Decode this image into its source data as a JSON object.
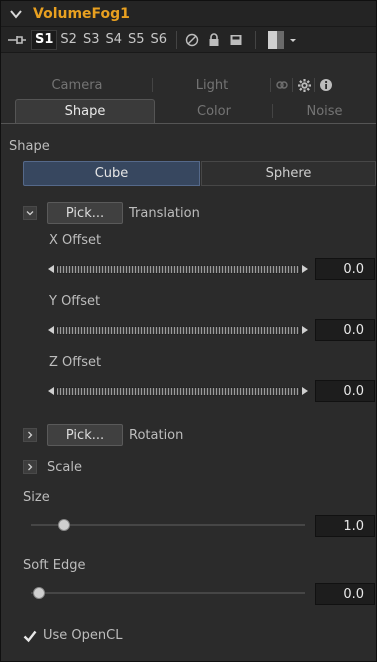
{
  "node": {
    "title": "VolumeFog1"
  },
  "versions": {
    "items": [
      "S1",
      "S2",
      "S3",
      "S4",
      "S5",
      "S6"
    ],
    "active_index": 0
  },
  "tabs_row1": [
    "Camera",
    "Light"
  ],
  "tabs_row2": [
    "Shape",
    "Color",
    "Noise"
  ],
  "active_tab": "Shape",
  "shape": {
    "section_label": "Shape",
    "options": [
      "Cube",
      "Sphere"
    ],
    "selected": "Cube"
  },
  "translation": {
    "pick_label": "Pick...",
    "label": "Translation",
    "x_label": "X Offset",
    "x_value": "0.0",
    "y_label": "Y Offset",
    "y_value": "0.0",
    "z_label": "Z Offset",
    "z_value": "0.0"
  },
  "rotation": {
    "pick_label": "Pick...",
    "label": "Rotation"
  },
  "scale": {
    "label": "Scale"
  },
  "size": {
    "label": "Size",
    "value": "1.0",
    "slider_fraction": 0.12
  },
  "soft_edge": {
    "label": "Soft Edge",
    "value": "0.0",
    "slider_fraction": 0.03
  },
  "opencl": {
    "label": "Use OpenCL",
    "checked": true
  },
  "colors": {
    "title": "#e8a020",
    "panel_bg": "#2b2b2b",
    "selected_segment": "#37475f"
  },
  "icons": {
    "collapse": "chevron-down-icon",
    "pin": "pin-icon",
    "disable": "circle-slash-icon",
    "lock": "lock-icon",
    "save": "save-icon",
    "settings": "gear-icon",
    "info": "info-icon",
    "link": "link-icon"
  }
}
